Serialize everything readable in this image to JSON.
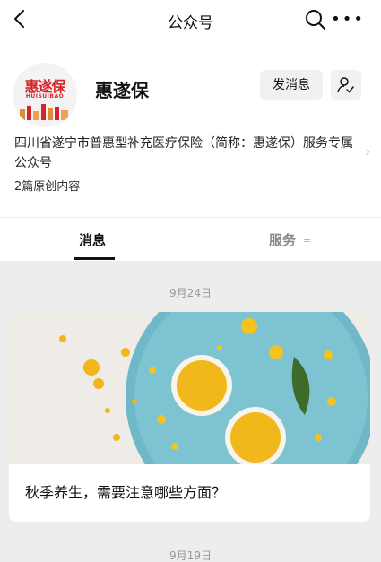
{
  "topbar": {
    "title": "公众号"
  },
  "profile": {
    "logo_title": "惠遂保",
    "logo_subtitle": "HUISUIBAO",
    "name": "惠遂保",
    "send_message_label": "发消息",
    "description": "四川省遂宁市普惠型补充医疗保险（简称：惠遂保）服务专属公众号",
    "original_count": "2篇原创内容"
  },
  "tabs": {
    "messages": "消息",
    "services": "服务"
  },
  "feed": {
    "date1": "9月24日",
    "article_title": "秋季养生，需要注意哪些方面？",
    "date2": "9月19日"
  },
  "colors": {
    "brand_red": "#d3262b",
    "plate_blue": "#6fb8c8",
    "flower_yellow": "#f0b81a"
  }
}
